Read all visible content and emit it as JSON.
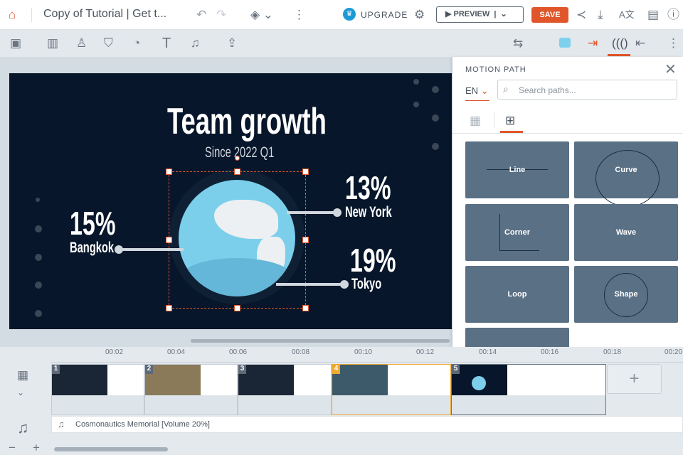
{
  "header": {
    "title": "Copy of Tutorial | Get t...",
    "upgrade": "UPGRADE",
    "preview": "PREVIEW",
    "save": "SAVE"
  },
  "slide": {
    "title": "Team growth",
    "subtitle": "Since 2022 Q1",
    "stats": [
      {
        "value": "15%",
        "city": "Bangkok"
      },
      {
        "value": "13%",
        "city": "New York"
      },
      {
        "value": "19%",
        "city": "Tokyo"
      }
    ]
  },
  "panel": {
    "title": "MOTION PATH",
    "lang": "EN",
    "search_placeholder": "Search paths...",
    "paths": [
      "Line",
      "Curve",
      "Corner",
      "Wave",
      "Loop",
      "Shape"
    ]
  },
  "timeline": {
    "ticks": [
      "00:02",
      "00:04",
      "00:06",
      "00:08",
      "00:10",
      "00:12",
      "00:14",
      "00:16",
      "00:18",
      "00:20"
    ],
    "scenes": [
      "1",
      "2",
      "3",
      "4",
      "5"
    ],
    "audio": "Cosmonautics Memorial [Volume 20%]"
  },
  "colors": {
    "accent": "#e0562a",
    "selected": "#f0a830",
    "card": "#5a7085",
    "slide": "#07162a"
  }
}
